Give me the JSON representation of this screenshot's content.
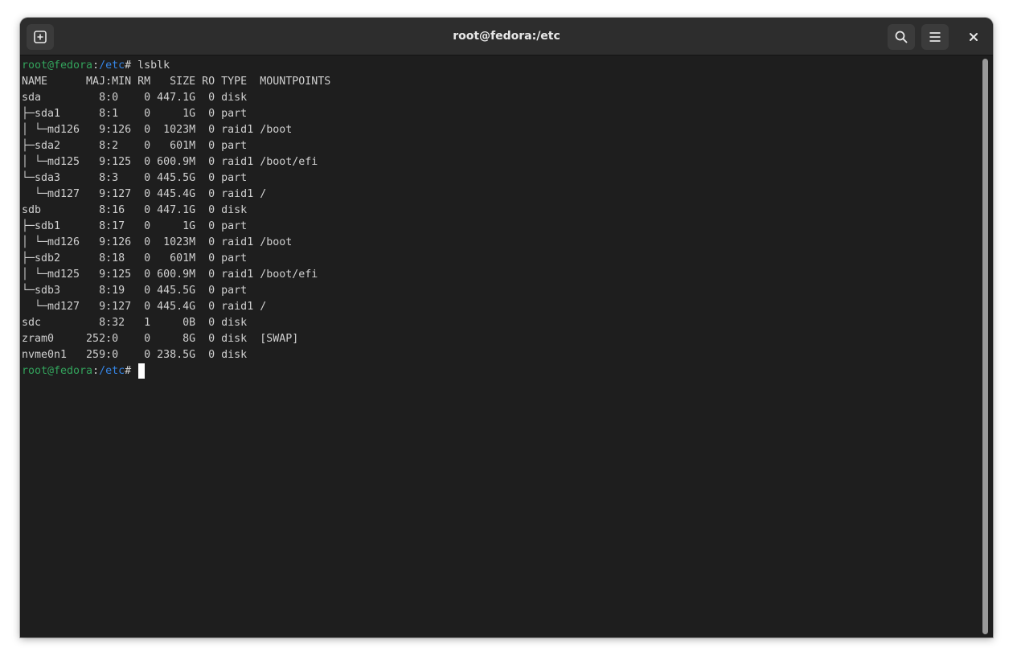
{
  "window": {
    "title": "root@fedora:/etc",
    "icons": {
      "new_tab": "new-tab-icon",
      "search": "search-icon",
      "menu": "hamburger-menu-icon",
      "close": "close-icon"
    }
  },
  "colors": {
    "background": "#1e1e1e",
    "headerbar": "#2d2d2d",
    "text": "#d0d0d0",
    "prompt_user": "#33a35c",
    "prompt_path": "#3584e4"
  },
  "terminal": {
    "prompt_user_host": "root@fedora",
    "prompt_colon": ":",
    "prompt_dir": "/etc",
    "prompt_symbol": "# ",
    "command": "lsblk",
    "output": [
      "NAME      MAJ:MIN RM   SIZE RO TYPE  MOUNTPOINTS",
      "sda         8:0    0 447.1G  0 disk",
      "├─sda1      8:1    0     1G  0 part",
      "│ └─md126   9:126  0  1023M  0 raid1 /boot",
      "├─sda2      8:2    0   601M  0 part",
      "│ └─md125   9:125  0 600.9M  0 raid1 /boot/efi",
      "└─sda3      8:3    0 445.5G  0 part",
      "  └─md127   9:127  0 445.4G  0 raid1 /",
      "sdb         8:16   0 447.1G  0 disk",
      "├─sdb1      8:17   0     1G  0 part",
      "│ └─md126   9:126  0  1023M  0 raid1 /boot",
      "├─sdb2      8:18   0   601M  0 part",
      "│ └─md125   9:125  0 600.9M  0 raid1 /boot/efi",
      "└─sdb3      8:19   0 445.5G  0 part",
      "  └─md127   9:127  0 445.4G  0 raid1 /",
      "sdc         8:32   1     0B  0 disk",
      "zram0     252:0    0     8G  0 disk  [SWAP]",
      "nvme0n1   259:0    0 238.5G  0 disk"
    ]
  }
}
